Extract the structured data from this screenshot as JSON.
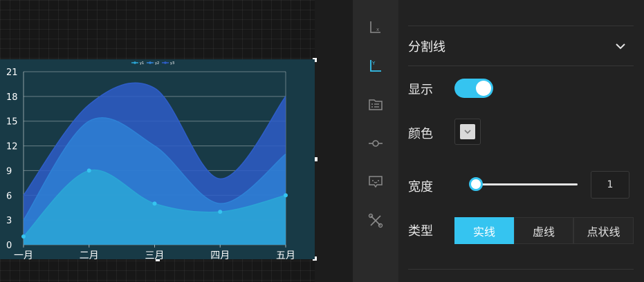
{
  "colors": {
    "accent": "#35c4f0",
    "series_y1": "#2ba6d6",
    "series_y2": "#2e82d6",
    "series_y3": "#2e5dc8"
  },
  "panel": {
    "section_title": "分割线",
    "show_label": "显示",
    "show_value": true,
    "color_label": "颜色",
    "width_label": "宽度",
    "width_value": "1",
    "type_label": "类型",
    "type_options": [
      "实线",
      "虚线",
      "点状线"
    ],
    "type_selected": "实线"
  },
  "rail": {
    "items": [
      "x-axis-icon",
      "y-axis-icon",
      "legend-icon",
      "series-point-icon",
      "tooltip-icon",
      "tools-icon"
    ],
    "selected": "y-axis-icon"
  },
  "chart_data": {
    "type": "area",
    "categories": [
      "一月",
      "二月",
      "三月",
      "四月",
      "五月"
    ],
    "series": [
      {
        "name": "y1",
        "values": [
          1,
          9,
          5,
          4,
          6
        ]
      },
      {
        "name": "y2",
        "values": [
          3,
          15,
          12,
          5,
          11
        ]
      },
      {
        "name": "y3",
        "values": [
          6,
          17,
          19,
          8,
          18
        ]
      }
    ],
    "ylim": [
      0,
      21
    ],
    "yticks": [
      "0",
      "3",
      "6",
      "9",
      "12",
      "15",
      "18",
      "21"
    ],
    "grid": true,
    "legend": "top-center"
  }
}
